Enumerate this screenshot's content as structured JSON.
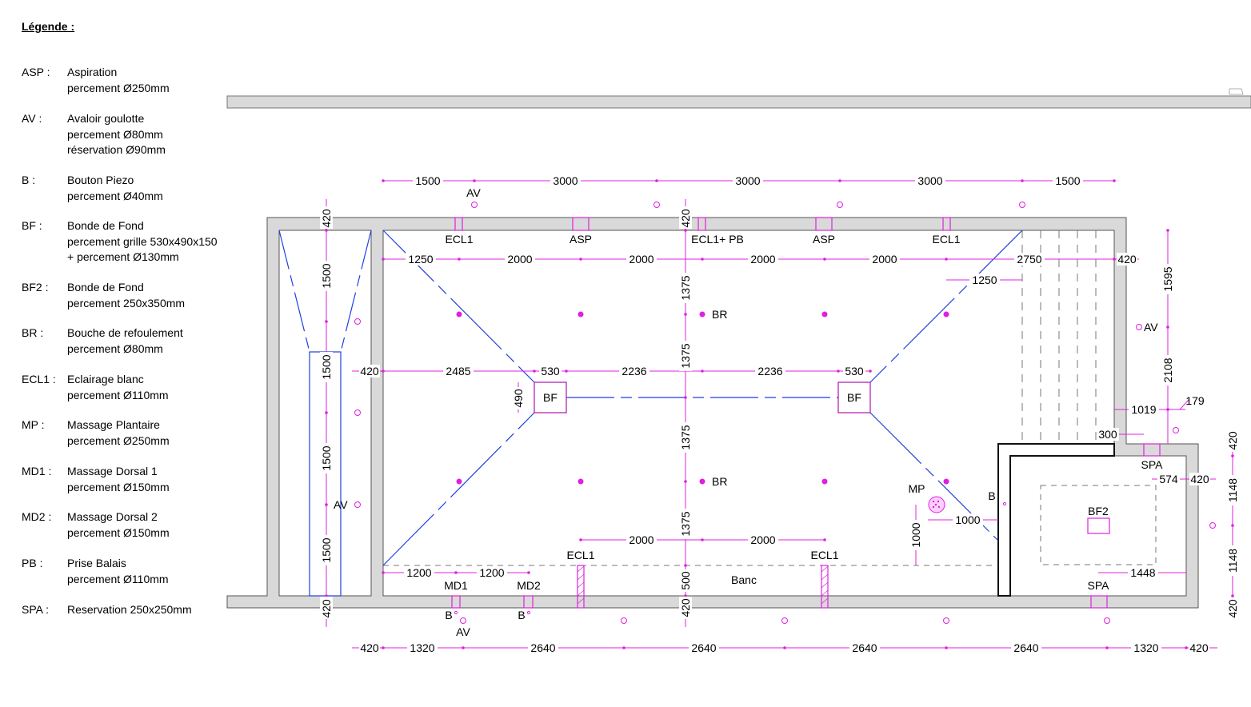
{
  "legend": {
    "title": "Légende :",
    "items": [
      {
        "code": "ASP :",
        "lines": [
          "Aspiration",
          "percement Ø250mm"
        ]
      },
      {
        "code": "AV :",
        "lines": [
          "Avaloir goulotte",
          "percement Ø80mm",
          "réservation Ø90mm"
        ]
      },
      {
        "code": "B :",
        "lines": [
          "Bouton Piezo",
          "percement Ø40mm"
        ]
      },
      {
        "code": "BF :",
        "lines": [
          "Bonde de Fond",
          "percement grille 530x490x150",
          "+ percement Ø130mm"
        ]
      },
      {
        "code": "BF2 :",
        "lines": [
          "Bonde de Fond",
          "percement 250x350mm"
        ]
      },
      {
        "code": "BR :",
        "lines": [
          "Bouche de refoulement",
          "percement Ø80mm"
        ]
      },
      {
        "code": "ECL1 :",
        "lines": [
          "Eclairage blanc",
          "percement Ø110mm"
        ]
      },
      {
        "code": "MP :",
        "lines": [
          "Massage Plantaire",
          "percement Ø250mm"
        ]
      },
      {
        "code": "MD1 :",
        "lines": [
          "Massage Dorsal 1",
          "percement Ø150mm"
        ]
      },
      {
        "code": "MD2 :",
        "lines": [
          "Massage Dorsal 2",
          "percement Ø150mm"
        ]
      },
      {
        "code": "PB :",
        "lines": [
          "Prise Balais",
          "percement Ø110mm"
        ]
      },
      {
        "code": "SPA :",
        "lines": [
          "Reservation 250x250mm"
        ]
      }
    ]
  },
  "plan": {
    "colors": {
      "dimension": "#e020e0",
      "drain_line": "#1f3fe0",
      "wall_fill": "#d9d9d9",
      "outline": "#555555"
    },
    "top_dims": [
      "1500",
      "3000",
      "3000",
      "3000",
      "1500"
    ],
    "row2_dims": [
      "1250",
      "2000",
      "2000",
      "2000",
      "2000",
      "2750",
      "420"
    ],
    "mid_dims": [
      "420",
      "2485",
      "530",
      "2236",
      "2236",
      "530"
    ],
    "bench_dims": [
      "2000",
      "2000"
    ],
    "bottom_left_dims": [
      "1200",
      "1200"
    ],
    "bottom_dims": [
      "420",
      "1320",
      "2640",
      "2640",
      "2640",
      "2640",
      "1320",
      "420"
    ],
    "left_vdims": [
      "420",
      "1500",
      "1500",
      "1500",
      "1500",
      "420"
    ],
    "center_vdims": [
      "420",
      "1375",
      "1375",
      "1375",
      "1375",
      "500",
      "420"
    ],
    "bf_vdim": "490",
    "right_vdims": [
      "1595",
      "2108"
    ],
    "spa_vdims": [
      "420",
      "1148",
      "1148",
      "420"
    ],
    "misc_dims": {
      "r1250": "1250",
      "r1019": "1019",
      "r179": "179",
      "r300": "300",
      "r574": "574",
      "r420": "420",
      "r1448": "1448",
      "v1000": "1000",
      "h1000": "1000"
    },
    "labels": {
      "ecl1_a": "ECL1",
      "asp_a": "ASP",
      "ecl1_pb": "ECL1+ PB",
      "asp_b": "ASP",
      "ecl1_b": "ECL1",
      "av_top": "AV",
      "av_right": "AV",
      "av_left": "AV",
      "av_bottom": "AV",
      "br_top": "BR",
      "br_bottom": "BR",
      "bf_left": "BF",
      "bf_right": "BF",
      "bf2": "BF2",
      "mp": "MP",
      "b_right": "B",
      "b_md1": "B",
      "b_md2": "B",
      "md1": "MD1",
      "md2": "MD2",
      "ecl1_c": "ECL1",
      "ecl1_d": "ECL1",
      "banc": "Banc",
      "spa_top": "SPA",
      "spa_bottom": "SPA"
    }
  }
}
